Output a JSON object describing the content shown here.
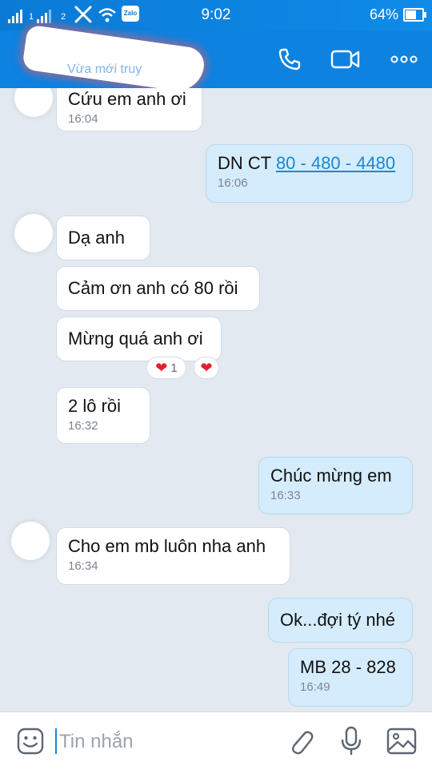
{
  "status_bar": {
    "sim1": "1",
    "sim2": "2",
    "app_badge": "Zalo",
    "time": "9:02",
    "battery": "64%",
    "battery_level": 0.64
  },
  "header": {
    "last_seen": "Vừa mới truy"
  },
  "messages": [
    {
      "side": "in",
      "text": "Cứu em anh ơi",
      "time": "16:04"
    },
    {
      "side": "out",
      "text_prefix": "DN CT ",
      "link": "80 - 480 - 4480",
      "time": "16:06"
    },
    {
      "side": "in",
      "text": "Dạ anh"
    },
    {
      "side": "in",
      "text": "Cảm ơn anh có 80 rồi"
    },
    {
      "side": "in",
      "text": "Mừng quá anh ơi",
      "reaction_count": "1"
    },
    {
      "side": "in",
      "text": "2 lô rồi",
      "time": "16:32"
    },
    {
      "side": "out",
      "text": "Chúc mừng em",
      "time": "16:33"
    },
    {
      "side": "in",
      "text": "Cho em mb luôn nha anh",
      "time": "16:34"
    },
    {
      "side": "out",
      "text": "Ok...đợi tý nhé"
    },
    {
      "side": "out",
      "text": "MB 28 - 828",
      "time": "16:49"
    }
  ],
  "input": {
    "placeholder": "Tin nhắn"
  },
  "icons": {
    "call": "phone-icon",
    "video": "video-camera-icon",
    "more": "more-dots-icon",
    "sticker": "sticker-icon",
    "attach": "paperclip-icon",
    "mic": "microphone-icon",
    "image": "image-icon",
    "heart": "heart-icon"
  },
  "colors": {
    "header": "#0d82e0",
    "chat_bg": "#e2e9f1",
    "my_bubble": "#d5ecfd",
    "their_bubble": "#ffffff",
    "link": "#1a87d8",
    "heart": "#e4202f"
  }
}
